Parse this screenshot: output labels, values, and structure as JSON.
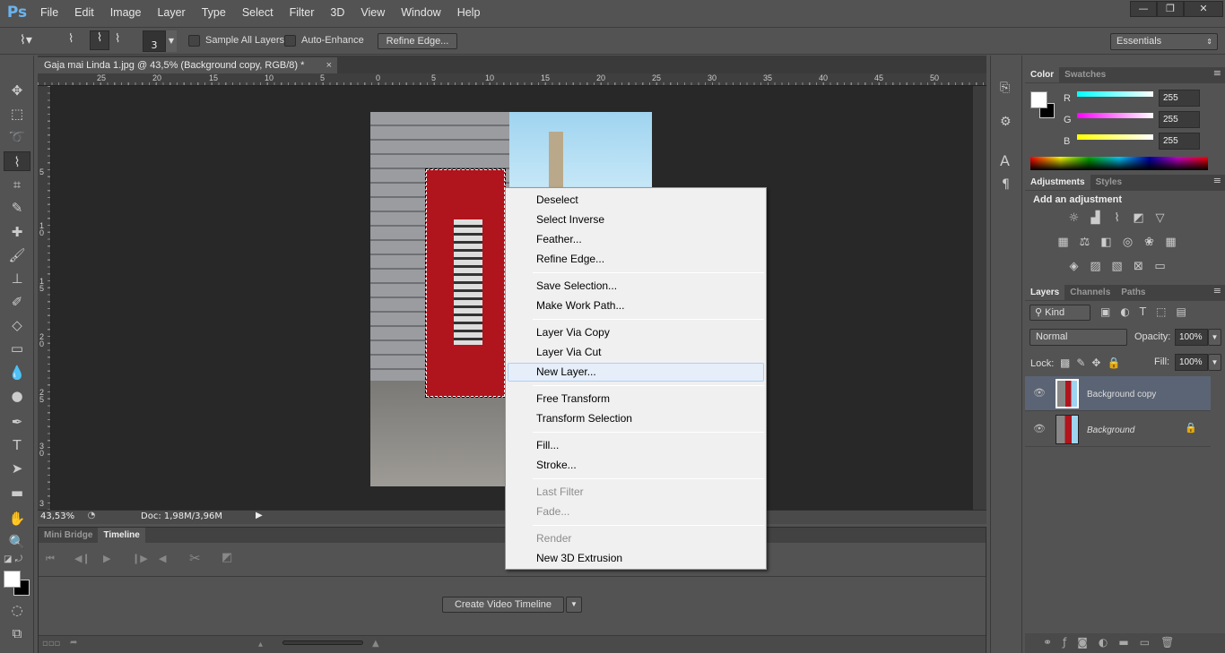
{
  "app": {
    "logo": "Ps"
  },
  "menu": [
    "File",
    "Edit",
    "Image",
    "Layer",
    "Type",
    "Select",
    "Filter",
    "3D",
    "View",
    "Window",
    "Help"
  ],
  "window_controls": {
    "minimize": "—",
    "restore": "❐",
    "close": "✕"
  },
  "options": {
    "brush_size": "3",
    "sample_all_layers": "Sample All Layers",
    "auto_enhance": "Auto-Enhance",
    "refine_edge": "Refine Edge...",
    "workspace": "Essentials"
  },
  "document": {
    "tab_title": "Gaja mai Linda 1.jpg @ 43,5% (Background copy, RGB/8) *",
    "close": "×"
  },
  "rulers": {
    "top": [
      "25",
      "20",
      "15",
      "10",
      "5",
      "0",
      "5",
      "10",
      "15",
      "20",
      "25",
      "30",
      "35",
      "40",
      "45",
      "50"
    ],
    "left": [
      "5",
      "1 0",
      "1 5",
      "2 0",
      "2 5",
      "3 0",
      "3"
    ]
  },
  "status": {
    "zoom": "43,53%",
    "doc": "Doc: 1,98M/3,96M"
  },
  "timeline": {
    "tabs": [
      "Mini Bridge",
      "Timeline"
    ],
    "active_tab": "Timeline",
    "create_button": "Create Video Timeline"
  },
  "color_panel": {
    "tabs": [
      "Color",
      "Swatches"
    ],
    "channels": [
      {
        "label": "R",
        "value": "255",
        "color": "#00ffff"
      },
      {
        "label": "G",
        "value": "255",
        "color": "#ff00ff"
      },
      {
        "label": "B",
        "value": "255",
        "color": "#ffff00"
      }
    ],
    "foreground": "#ffffff",
    "background": "#000000"
  },
  "adjustments_panel": {
    "tabs": [
      "Adjustments",
      "Styles"
    ],
    "heading": "Add an adjustment"
  },
  "layers_panel": {
    "tabs": [
      "Layers",
      "Channels",
      "Paths"
    ],
    "filter": "Kind",
    "blend_mode": "Normal",
    "opacity_label": "Opacity:",
    "opacity": "100%",
    "lock_label": "Lock:",
    "fill_label": "Fill:",
    "fill": "100%",
    "layers": [
      {
        "name": "Background copy",
        "selected": true,
        "locked": false
      },
      {
        "name": "Background",
        "selected": false,
        "locked": true
      }
    ]
  },
  "context_menu": {
    "items": [
      {
        "label": "Deselect",
        "enabled": true
      },
      {
        "label": "Select Inverse",
        "enabled": true
      },
      {
        "label": "Feather...",
        "enabled": true
      },
      {
        "label": "Refine Edge...",
        "enabled": true
      },
      {
        "label": "Save Selection...",
        "enabled": true
      },
      {
        "label": "Make Work Path...",
        "enabled": true
      },
      {
        "label": "Layer Via Copy",
        "enabled": true
      },
      {
        "label": "Layer Via Cut",
        "enabled": true
      },
      {
        "label": "New Layer...",
        "enabled": true,
        "highlighted": true
      },
      {
        "label": "Free Transform",
        "enabled": true
      },
      {
        "label": "Transform Selection",
        "enabled": true
      },
      {
        "label": "Fill...",
        "enabled": true
      },
      {
        "label": "Stroke...",
        "enabled": true
      },
      {
        "label": "Last Filter",
        "enabled": false
      },
      {
        "label": "Fade...",
        "enabled": false
      },
      {
        "label": "Render",
        "enabled": false
      },
      {
        "label": "New 3D Extrusion",
        "enabled": true
      }
    ]
  }
}
